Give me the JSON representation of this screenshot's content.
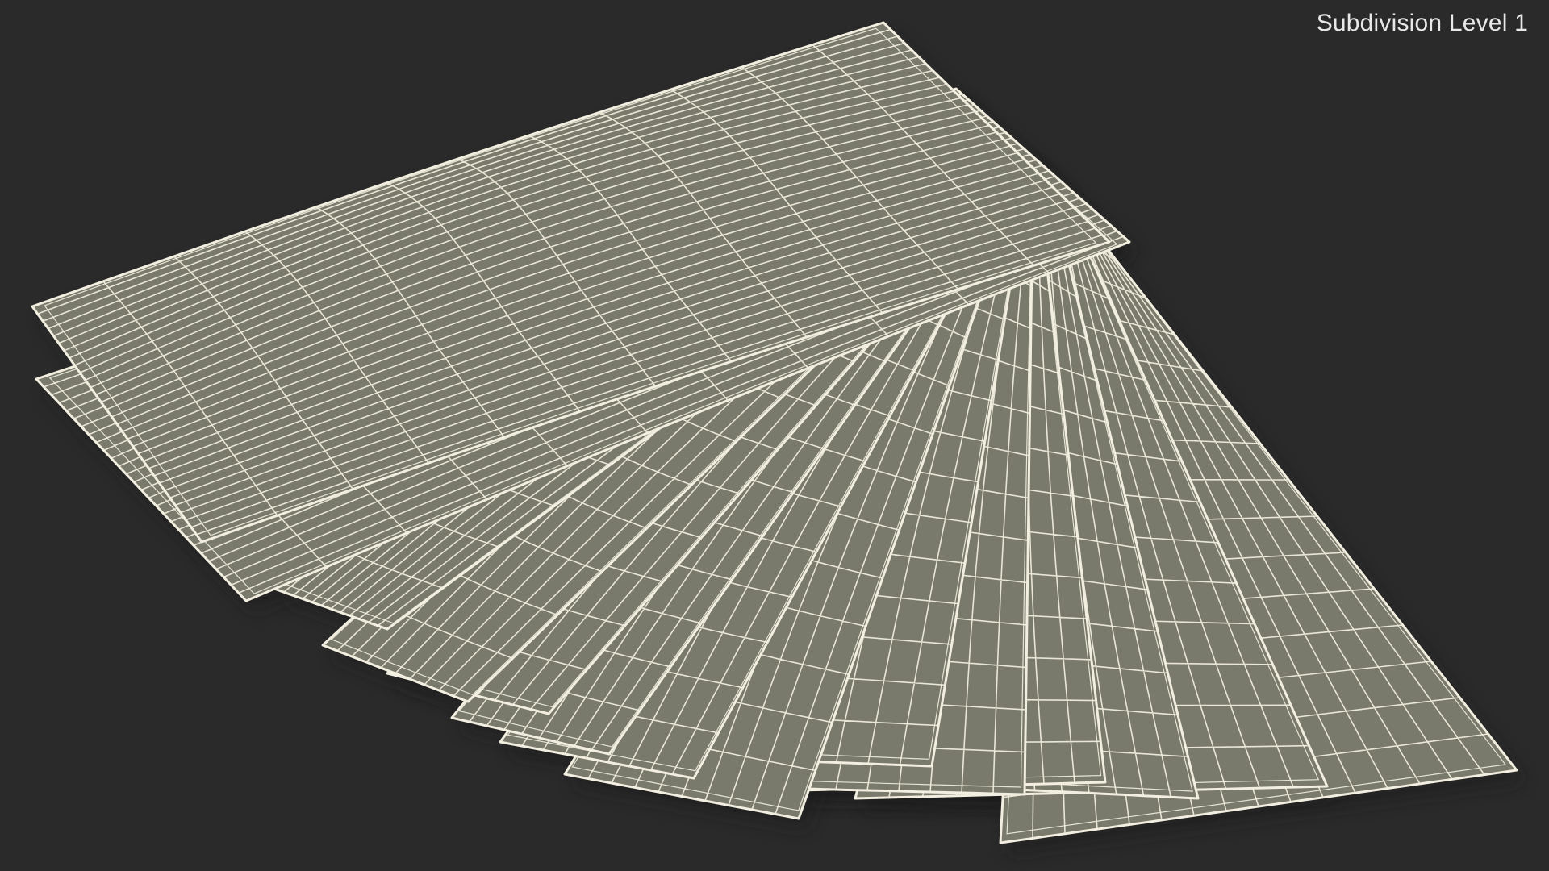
{
  "overlay": {
    "label": "Subdivision Level 1"
  },
  "scene": {
    "background_color": "#2a2a2a",
    "surface_color": "#7a7a6c",
    "wire_color": "#f2efe0",
    "shadow_color": "#1f1f1f",
    "sheet_count": 14,
    "wireframe_grid": true
  }
}
